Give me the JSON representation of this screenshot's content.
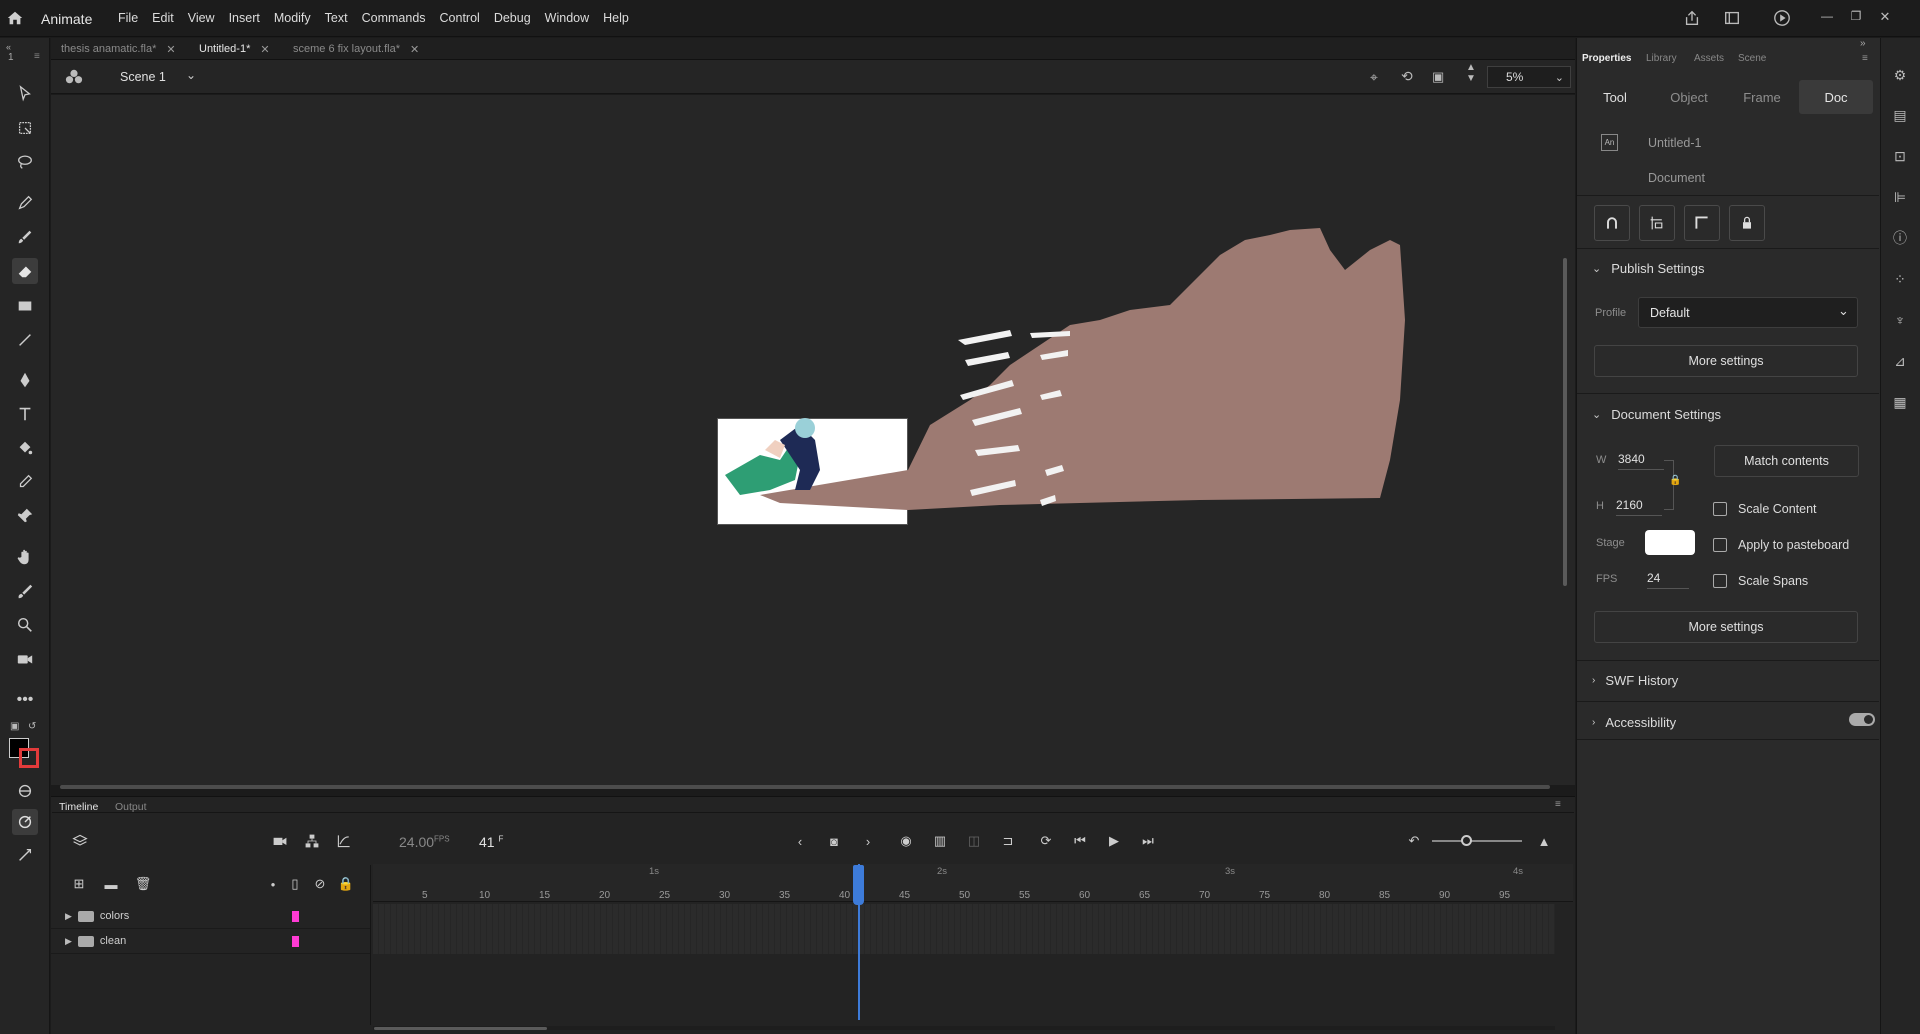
{
  "app": {
    "name": "Animate"
  },
  "menu": [
    "File",
    "Edit",
    "View",
    "Insert",
    "Modify",
    "Text",
    "Commands",
    "Control",
    "Debug",
    "Window",
    "Help"
  ],
  "tabs": [
    {
      "label": "thesis anamatic.fla*"
    },
    {
      "label": "Untitled-1*"
    },
    {
      "label": "sceme 6 fix layout.fla*"
    }
  ],
  "scene": {
    "label": "Scene 1",
    "zoom": "5%"
  },
  "panel_counter": "1",
  "timeline": {
    "tabs": {
      "timeline": "Timeline",
      "output": "Output"
    },
    "fps": "24.00",
    "fps_unit": "FPS",
    "frame": "41",
    "frame_unit": "F",
    "seconds": [
      "1s",
      "2s",
      "3s",
      "4s"
    ],
    "frame_numbers": [
      "5",
      "10",
      "15",
      "20",
      "25",
      "30",
      "35",
      "40",
      "45",
      "50",
      "55",
      "60",
      "65",
      "70",
      "75",
      "80",
      "85",
      "90",
      "95"
    ],
    "layers": [
      {
        "name": "colors",
        "color": "#ff3bd4"
      },
      {
        "name": "clean",
        "color": "#ff3bd4"
      }
    ],
    "playhead_frame": 41
  },
  "properties": {
    "tabs": [
      "Properties",
      "Library",
      "Assets",
      "Scene"
    ],
    "segments": [
      "Tool",
      "Object",
      "Frame",
      "Doc"
    ],
    "doc_name": "Untitled-1",
    "doc_type": "Document",
    "doc_icon_label": "An",
    "publish": {
      "title": "Publish Settings",
      "profile_label": "Profile",
      "profile_value": "Default",
      "more": "More settings"
    },
    "document": {
      "title": "Document Settings",
      "w_label": "W",
      "w_value": "3840",
      "h_label": "H",
      "h_value": "2160",
      "match": "Match contents",
      "stage_label": "Stage",
      "stage_color": "#ffffff",
      "fps_label": "FPS",
      "fps_value": "24",
      "scale_content": "Scale Content",
      "apply_pasteboard": "Apply to pasteboard",
      "scale_spans": "Scale Spans",
      "more": "More settings"
    },
    "swf_history": "SWF History",
    "accessibility": "Accessibility"
  },
  "colors": {
    "accent": "#4a90e2",
    "playhead": "#3d7bd9",
    "shape": "#9d7a72"
  }
}
